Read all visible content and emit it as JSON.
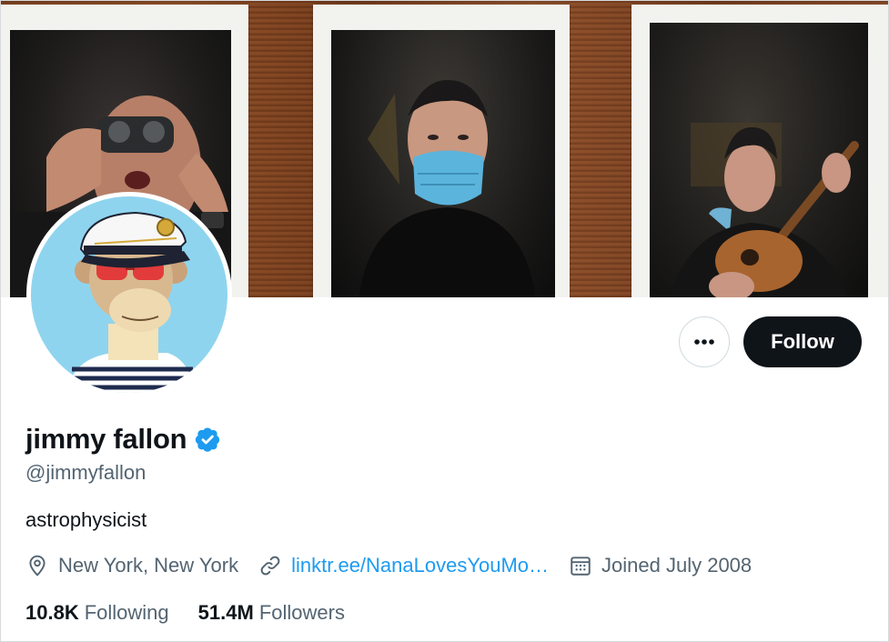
{
  "profile": {
    "name": "jimmy fallon",
    "handle": "@jimmyfallon",
    "bio": "astrophysicist",
    "location": "New York, New York",
    "link": "linktr.ee/NanaLovesYouMo…",
    "joined": "Joined July 2008",
    "verified": true
  },
  "actions": {
    "more_label": "•••",
    "follow_label": "Follow"
  },
  "stats": {
    "following_count": "10.8K",
    "following_label": "Following",
    "followers_count": "51.4M",
    "followers_label": "Followers"
  },
  "icons": {
    "location": "location-pin-icon",
    "link": "link-icon",
    "calendar": "calendar-icon",
    "verified": "verified-badge-icon",
    "more": "more-dots-icon"
  },
  "colors": {
    "accent": "#1d9bf0",
    "follow_bg": "#0f1419",
    "secondary_text": "#536471",
    "avatar_bg": "#8fd4ee"
  }
}
